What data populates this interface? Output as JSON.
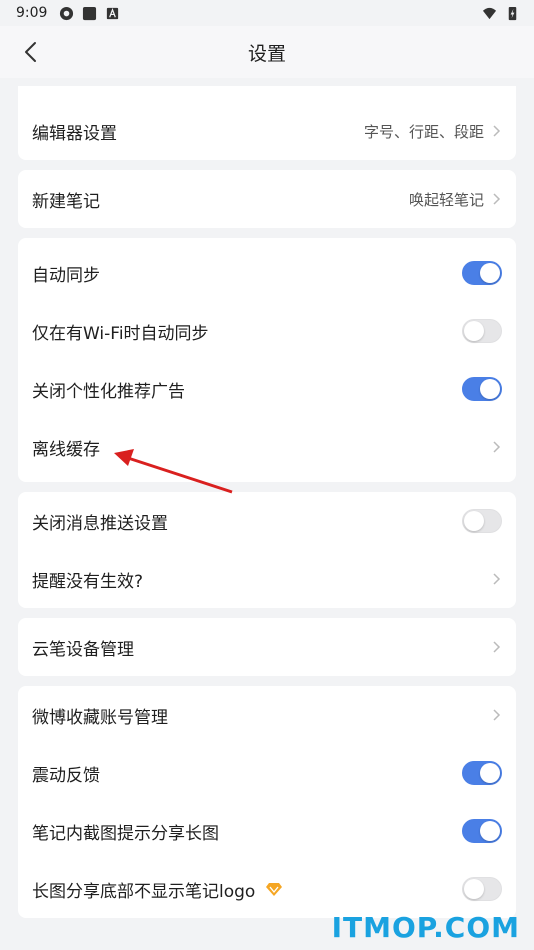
{
  "status_bar": {
    "time": "9:09"
  },
  "header": {
    "title": "设置"
  },
  "cards": [
    {
      "rows": [
        {
          "label": "编辑器设置",
          "value": "字号、行距、段距",
          "type": "nav"
        }
      ]
    },
    {
      "rows": [
        {
          "label": "新建笔记",
          "value": "唤起轻笔记",
          "type": "nav"
        }
      ]
    },
    {
      "rows": [
        {
          "label": "自动同步",
          "type": "toggle",
          "on": true
        },
        {
          "label": "仅在有Wi-Fi时自动同步",
          "type": "toggle",
          "on": false
        },
        {
          "label": "关闭个性化推荐广告",
          "type": "toggle",
          "on": true
        },
        {
          "label": "离线缓存",
          "type": "nav"
        }
      ]
    },
    {
      "rows": [
        {
          "label": "关闭消息推送设置",
          "type": "toggle",
          "on": false
        },
        {
          "label": "提醒没有生效?",
          "type": "nav"
        }
      ]
    },
    {
      "rows": [
        {
          "label": "云笔设备管理",
          "type": "nav"
        }
      ]
    },
    {
      "rows": [
        {
          "label": "微博收藏账号管理",
          "type": "nav"
        },
        {
          "label": "震动反馈",
          "type": "toggle",
          "on": true
        },
        {
          "label": "笔记内截图提示分享长图",
          "type": "toggle",
          "on": true
        },
        {
          "label": "长图分享底部不显示笔记logo",
          "type": "toggle",
          "on": false,
          "vip_icon": "diamond-vip-icon"
        }
      ]
    }
  ],
  "watermark": "ITMOP.COM",
  "colors": {
    "accent": "#4a7fe6",
    "annotation_arrow": "#d9201f"
  }
}
